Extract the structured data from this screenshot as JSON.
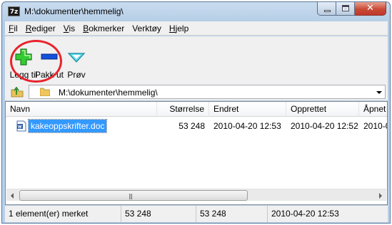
{
  "window": {
    "title": "M:\\dokumenter\\hemmelig\\",
    "app_icon_text": "7z"
  },
  "menu": [
    {
      "label": "Fil",
      "underline": "F",
      "rest": "il"
    },
    {
      "label": "Rediger",
      "underline": "R",
      "rest": "ediger"
    },
    {
      "label": "Vis",
      "underline": "V",
      "rest": "is"
    },
    {
      "label": "Bokmerker",
      "underline": "B",
      "rest": "okmerker"
    },
    {
      "label": "Verktøy",
      "underline": "",
      "rest": "Verktøy"
    },
    {
      "label": "Hjelp",
      "underline": "H",
      "rest": "jelp"
    }
  ],
  "toolbar": {
    "add_label": "Legg til",
    "extract_label": "Pakk ut",
    "test_label": "Prøv"
  },
  "path": {
    "value": "M:\\dokumenter\\hemmelig\\"
  },
  "list": {
    "columns": [
      "Navn",
      "Størrelse",
      "Endret",
      "Opprettet",
      "Åpnet"
    ],
    "rows": [
      {
        "name": "kakeoppskrifter.doc",
        "size": "53 248",
        "modified": "2010-04-20 12:53",
        "created": "2010-04-20 12:52",
        "accessed": "2010-04"
      }
    ]
  },
  "status": {
    "selected": "1 element(er) merket",
    "size": "53 248",
    "packed": "53 248",
    "modified": "2010-04-20 12:53"
  },
  "colors": {
    "selection": "#3399ff",
    "highlight_circle": "#e8232b"
  },
  "icons": {
    "add": "plus-icon",
    "extract": "minus-icon",
    "test": "check-chevron-icon",
    "up": "folder-up-icon",
    "folder": "folder-icon",
    "file": "word-document-icon"
  }
}
